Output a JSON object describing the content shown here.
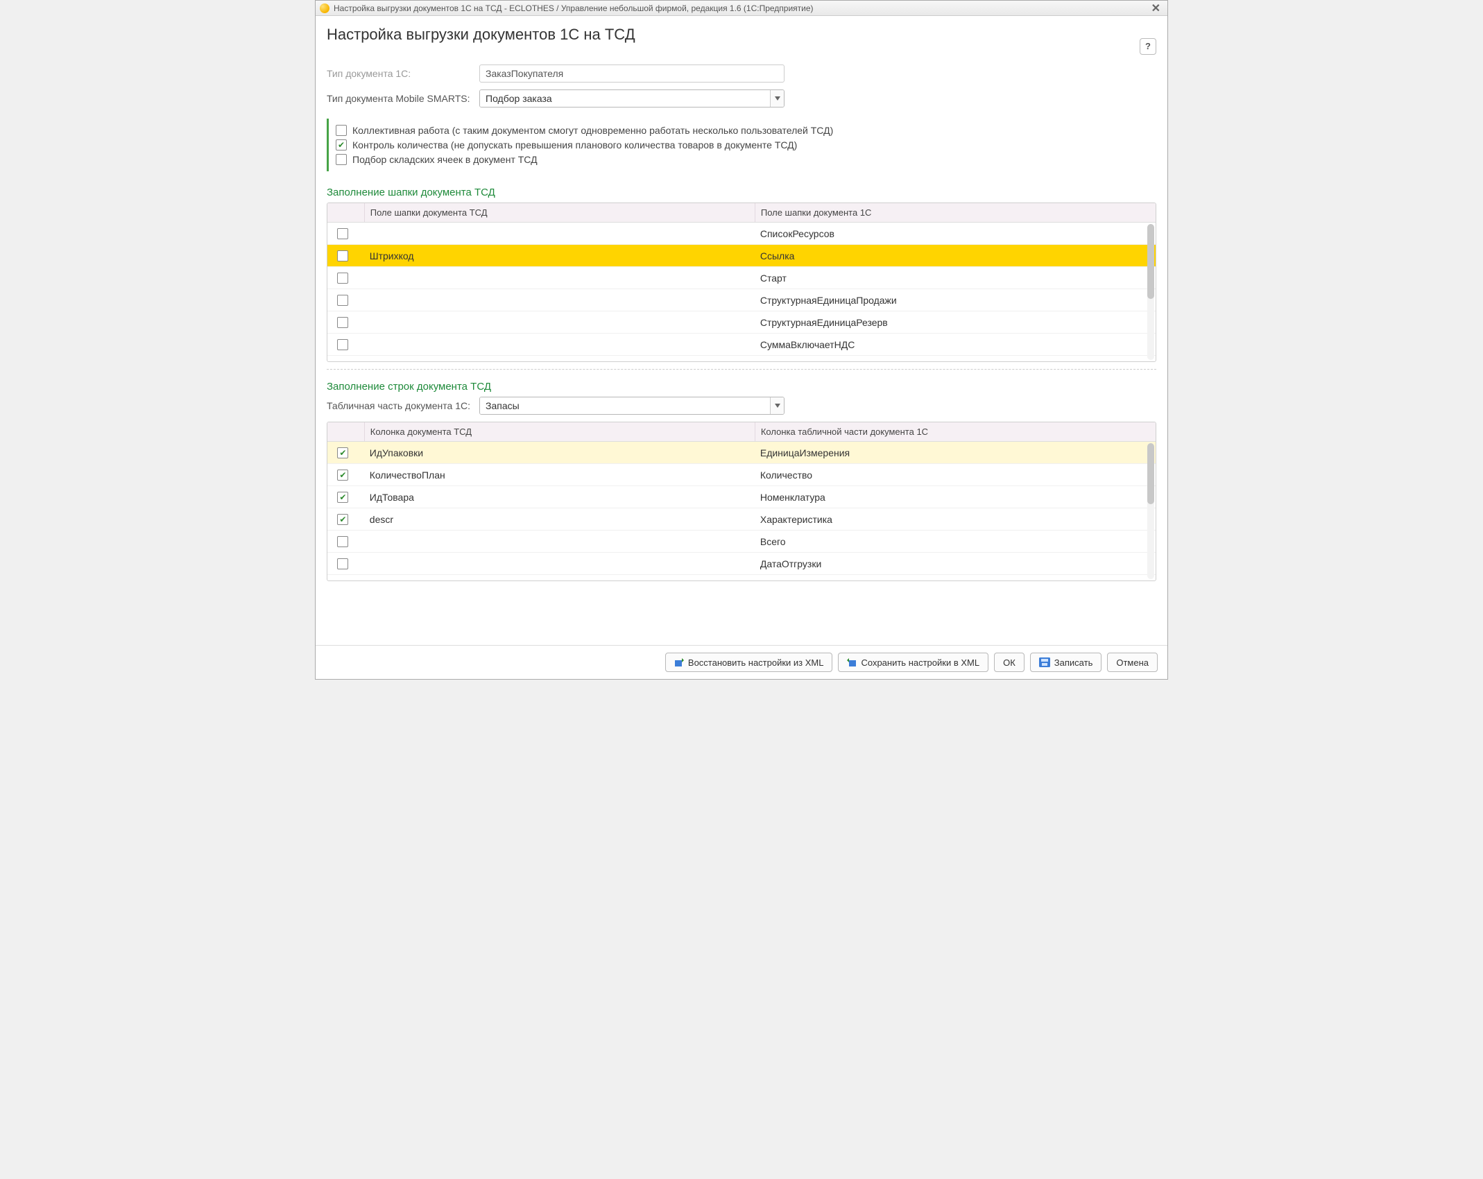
{
  "window": {
    "title": "Настройка выгрузки документов 1С на ТСД - ECLOTHES / Управление небольшой фирмой, редакция 1.6  (1С:Предприятие)"
  },
  "pageTitle": "Настройка выгрузки документов 1С на ТСД",
  "help": "?",
  "form": {
    "docType1C_label": "Тип документа 1С:",
    "docType1C_value": "ЗаказПокупателя",
    "docTypeMS_label": "Тип документа Mobile SMARTS:",
    "docTypeMS_value": "Подбор заказа",
    "tabPart_label": "Табличная часть документа 1С:",
    "tabPart_value": "Запасы"
  },
  "options": [
    {
      "checked": false,
      "label": "Коллективная работа (с таким документом смогут одновременно работать несколько пользователей ТСД)"
    },
    {
      "checked": true,
      "label": "Контроль количества (не допускать превышения планового количества товаров в документе ТСД)"
    },
    {
      "checked": false,
      "label": "Подбор складских ячеек в документ ТСД"
    }
  ],
  "sections": {
    "header": {
      "title": "Заполнение шапки документа ТСД",
      "col_tsd": "Поле шапки документа ТСД",
      "col_1c": "Поле шапки документа 1С",
      "rows": [
        {
          "checked": false,
          "tsd": "",
          "c1": "СписокРесурсов",
          "sel": ""
        },
        {
          "checked": false,
          "tsd": "Штрихкод",
          "c1": "Ссылка",
          "sel": "strong"
        },
        {
          "checked": false,
          "tsd": "",
          "c1": "Старт",
          "sel": ""
        },
        {
          "checked": false,
          "tsd": "",
          "c1": "СтруктурнаяЕдиницаПродажи",
          "sel": ""
        },
        {
          "checked": false,
          "tsd": "",
          "c1": "СтруктурнаяЕдиницаРезерв",
          "sel": ""
        },
        {
          "checked": false,
          "tsd": "",
          "c1": "СуммаВключаетНДС",
          "sel": ""
        }
      ]
    },
    "lines": {
      "title": "Заполнение строк документа ТСД",
      "col_tsd": "Колонка документа ТСД",
      "col_1c": "Колонка табличной части документа 1С",
      "rows": [
        {
          "checked": true,
          "tsd": "ИдУпаковки",
          "c1": "ЕдиницаИзмерения",
          "sel": "light"
        },
        {
          "checked": true,
          "tsd": "КоличествоПлан",
          "c1": "Количество",
          "sel": ""
        },
        {
          "checked": true,
          "tsd": "ИдТовара",
          "c1": "Номенклатура",
          "sel": ""
        },
        {
          "checked": true,
          "tsd": "descr",
          "c1": "Характеристика",
          "sel": ""
        },
        {
          "checked": false,
          "tsd": "",
          "c1": "Всего",
          "sel": ""
        },
        {
          "checked": false,
          "tsd": "",
          "c1": "ДатаОтгрузки",
          "sel": ""
        }
      ]
    }
  },
  "footer": {
    "restore": "Восстановить настройки из XML",
    "save": "Сохранить настройки в XML",
    "ok": "ОК",
    "write": "Записать",
    "cancel": "Отмена"
  }
}
